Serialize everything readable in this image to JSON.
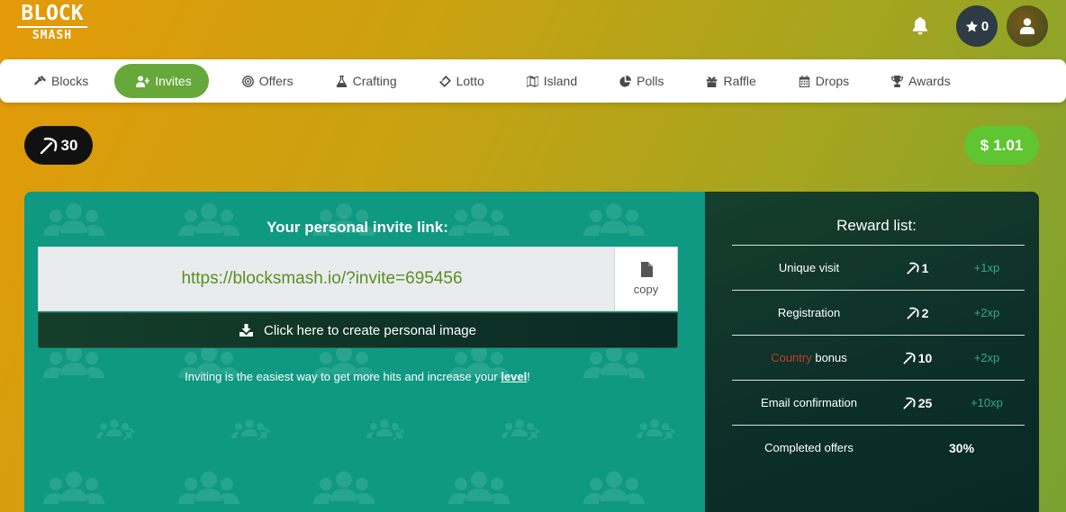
{
  "logo": {
    "line1": "BLOCK",
    "line2": "SMASH"
  },
  "header": {
    "stars_count": "0"
  },
  "nav": {
    "items": [
      {
        "label": "Blocks",
        "icon": "hammer-icon"
      },
      {
        "label": "Invites",
        "icon": "user-plus-icon",
        "active": true
      },
      {
        "label": "Offers",
        "icon": "bullseye-icon"
      },
      {
        "label": "Crafting",
        "icon": "flask-icon"
      },
      {
        "label": "Lotto",
        "icon": "ticket-icon"
      },
      {
        "label": "Island",
        "icon": "map-icon"
      },
      {
        "label": "Polls",
        "icon": "pie-chart-icon"
      },
      {
        "label": "Raffle",
        "icon": "gift-icon"
      },
      {
        "label": "Drops",
        "icon": "calendar-icon"
      },
      {
        "label": "Awards",
        "icon": "trophy-icon"
      }
    ]
  },
  "balance": {
    "hits": "30",
    "money": "1.01",
    "currency": "$"
  },
  "invite": {
    "title": "Your personal invite link:",
    "link": "https://blocksmash.io/?invite=695456",
    "copy_label": "copy",
    "create_button": "Click here to create personal image",
    "note_before": "Inviting is the easiest way to get more hits and increase your ",
    "note_link": "level",
    "note_after": "!"
  },
  "rewards": {
    "title": "Reward list:",
    "rows": [
      {
        "name": "Unique visit",
        "hits": "1",
        "xp": "+1xp"
      },
      {
        "name": "Registration",
        "hits": "2",
        "xp": "+2xp"
      },
      {
        "name_highlight": "Country",
        "name_rest": " bonus",
        "hits": "10",
        "xp": "+2xp"
      },
      {
        "name": "Email confirmation",
        "hits": "25",
        "xp": "+10xp"
      },
      {
        "name": "Completed offers",
        "percent": "30%"
      }
    ]
  },
  "colors": {
    "accent_green": "#66a83a",
    "money_green": "#5fc631",
    "panel_teal": "#0f9882",
    "panel_dark": "#0d2f29",
    "link_green": "#5a8f1e",
    "country_red": "#c63a2a"
  }
}
